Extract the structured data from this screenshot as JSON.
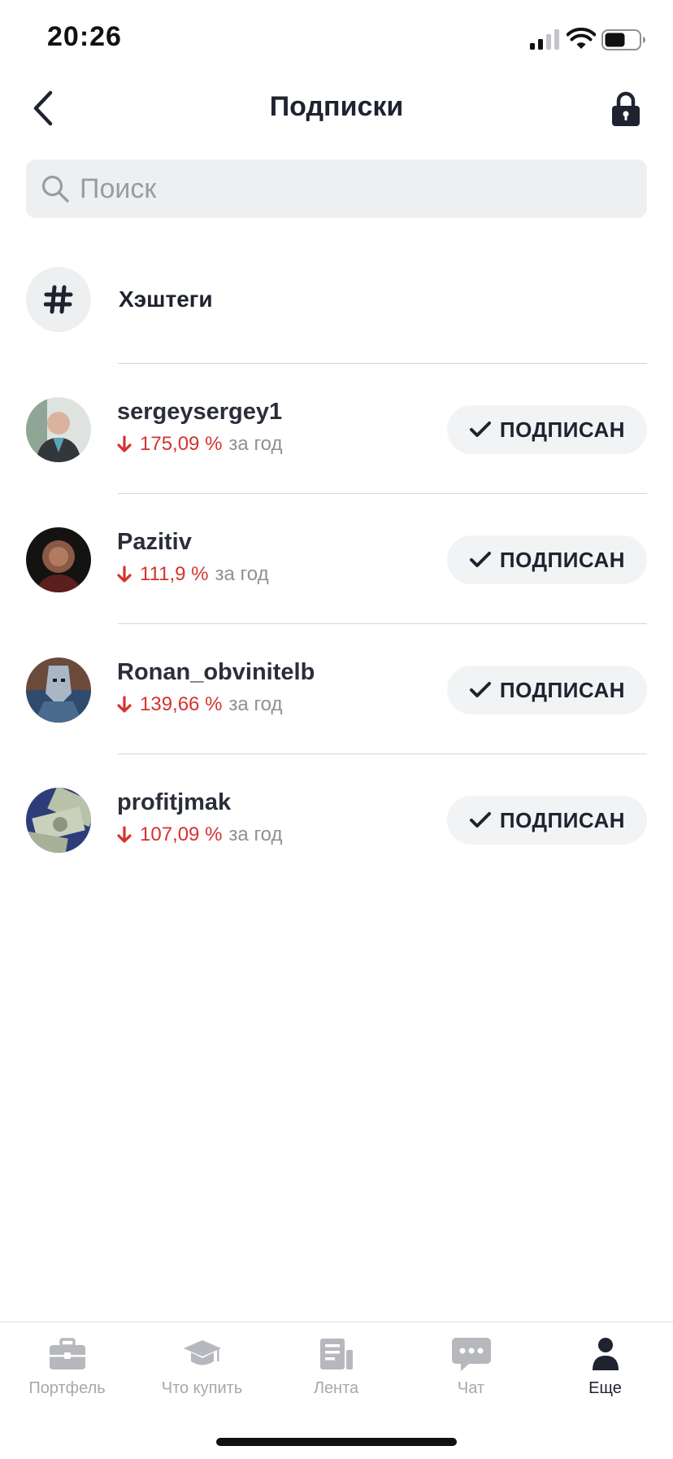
{
  "status_bar": {
    "time": "20:26"
  },
  "nav": {
    "title": "Подписки",
    "back_icon": "chevron-left-icon",
    "lock_icon": "lock-icon"
  },
  "search": {
    "placeholder": "Поиск",
    "value": ""
  },
  "hashtags": {
    "label": "Хэштеги",
    "icon": "hashtag-icon"
  },
  "subscriptions": [
    {
      "name": "sergeysergey1",
      "value": "175,09 %",
      "period": "за год",
      "button": "ПОДПИСАН"
    },
    {
      "name": "Pazitiv",
      "value": "111,9 %",
      "period": "за год",
      "button": "ПОДПИСАН"
    },
    {
      "name": "Ronan_obvinitelb",
      "value": "139,66 %",
      "period": "за год",
      "button": "ПОДПИСАН"
    },
    {
      "name": "profitjmak",
      "value": "107,09 %",
      "period": "за год",
      "button": "ПОДПИСАН"
    }
  ],
  "tabs": [
    {
      "label": "Портфель",
      "icon": "briefcase-icon",
      "active": false
    },
    {
      "label": "Что купить",
      "icon": "graduation-cap-icon",
      "active": false
    },
    {
      "label": "Лента",
      "icon": "news-feed-icon",
      "active": false
    },
    {
      "label": "Чат",
      "icon": "chat-bubble-icon",
      "active": false
    },
    {
      "label": "Еще",
      "icon": "person-icon",
      "active": true
    }
  ],
  "colors": {
    "accent_negative": "#d5332f",
    "text_primary": "#1f2330",
    "text_secondary": "#8e9097",
    "search_bg": "#eeeff1",
    "tab_inactive": "#a6a8ae"
  }
}
